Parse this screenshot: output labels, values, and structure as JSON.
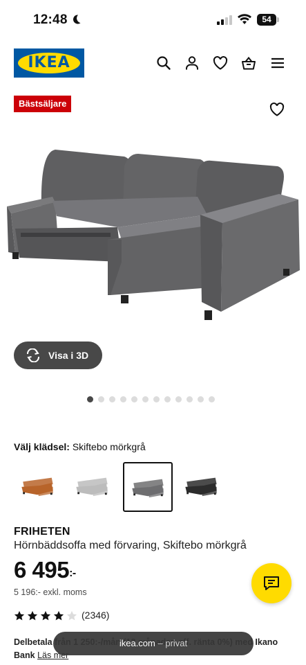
{
  "status_bar": {
    "time": "12:48",
    "battery": "54"
  },
  "header": {
    "logo_text": "IKEA",
    "icons": [
      "search-icon",
      "user-icon",
      "heart-icon",
      "basket-icon",
      "menu-icon"
    ]
  },
  "badge": "Bästsäljare",
  "product": {
    "view_3d_label": "Visa i 3D",
    "image_count": 12,
    "active_image": 1,
    "fabric_label": "Välj klädsel:",
    "fabric_value": "Skiftebo mörkgrå",
    "swatches": [
      {
        "name": "Skiftebo orange",
        "color": "#b8642a",
        "selected": false
      },
      {
        "name": "Skiftebo ljusgrå",
        "color": "#bcbcbc",
        "selected": false
      },
      {
        "name": "Skiftebo mörkgrå",
        "color": "#6e6e70",
        "selected": true
      },
      {
        "name": "Skiftebo svart",
        "color": "#2c2c2c",
        "selected": false
      }
    ],
    "brand": "FRIHETEN",
    "description": "Hörnbäddsoffa med förvaring, Skiftebo mörkgrå",
    "price": "6 495",
    "price_suffix": ":-",
    "price_ex_vat": "5 196:- exkl. moms",
    "rating": 4,
    "rating_max": 5,
    "review_count": "(2346)",
    "installment_text": "Delbetala från 1 250:-/mån (12 månader, eff. ränta 0%) med Ikano Bank",
    "read_more": "Läs mer"
  },
  "browser": {
    "domain": "ikea.com",
    "mode": "– privat"
  },
  "colors": {
    "ikea_blue": "#0058a3",
    "ikea_yellow": "#ffdb00",
    "badge_red": "#cc0008",
    "dark_button": "#484848"
  }
}
